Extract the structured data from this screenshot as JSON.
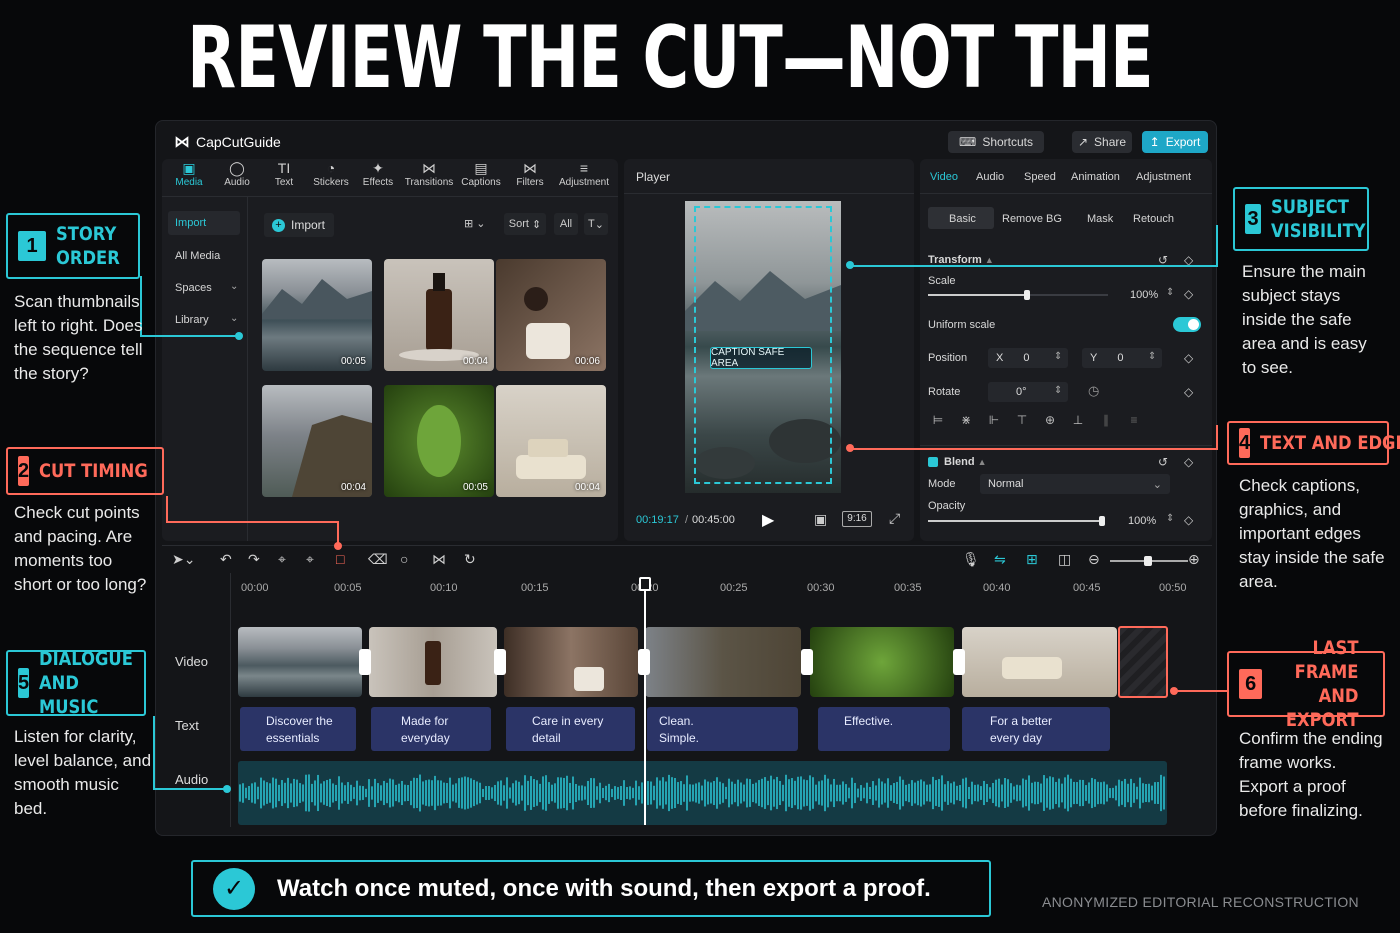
{
  "headline": "REVIEW THE CUT—NOT THE EFFECTS",
  "app": {
    "logo": "CapCutGuide",
    "shortcuts": "Shortcuts",
    "share": "Share",
    "export": "Export"
  },
  "toolbar": {
    "items": [
      {
        "label": "Media",
        "icon": "media-icon"
      },
      {
        "label": "Audio",
        "icon": "audio-icon"
      },
      {
        "label": "Text",
        "icon": "text-icon"
      },
      {
        "label": "Stickers",
        "icon": "stickers-icon"
      },
      {
        "label": "Effects",
        "icon": "effects-icon"
      },
      {
        "label": "Transitions",
        "icon": "transitions-icon"
      },
      {
        "label": "Captions",
        "icon": "captions-icon"
      },
      {
        "label": "Filters",
        "icon": "filters-icon"
      },
      {
        "label": "Adjustment",
        "icon": "adjustment-icon"
      }
    ]
  },
  "sidebar": {
    "items": [
      "Import",
      "All Media",
      "Spaces",
      "Library"
    ]
  },
  "media": {
    "import": "Import",
    "sort": "Sort",
    "all": "All",
    "type": "T",
    "thumbs": [
      {
        "duration": "00:05",
        "subject": "mountain lake"
      },
      {
        "duration": "00:04",
        "subject": "amber bottle"
      },
      {
        "duration": "00:06",
        "subject": "pouring cup"
      },
      {
        "duration": "00:04",
        "subject": "coastal cliffs"
      },
      {
        "duration": "00:05",
        "subject": "green leaves"
      },
      {
        "duration": "00:04",
        "subject": "soap and towels"
      }
    ]
  },
  "player": {
    "label": "Player",
    "caption_safe": "CAPTION SAFE AREA",
    "current_time": "00:19:17",
    "total_time": "00:45:00",
    "ratio": "9:16"
  },
  "props": {
    "tabs": [
      "Video",
      "Audio",
      "Speed",
      "Animation",
      "Adjustment"
    ],
    "subtabs": [
      "Basic",
      "Remove BG",
      "Mask",
      "Retouch"
    ],
    "transform": "Transform",
    "scale_label": "Scale",
    "scale_value": "100%",
    "scale_level": 0.55,
    "uniform_scale": "Uniform scale",
    "position": "Position",
    "x_label": "X",
    "x_value": "0",
    "y_label": "Y",
    "y_value": "0",
    "rotate": "Rotate",
    "rotate_value": "0°",
    "blend": "Blend",
    "mode": "Mode",
    "mode_value": "Normal",
    "opacity": "Opacity",
    "opacity_value": "100%",
    "opacity_level": 1.0
  },
  "timeline": {
    "ruler": [
      "00:00",
      "00:05",
      "00:10",
      "00:15",
      "00:20",
      "00:25",
      "00:30",
      "00:35",
      "00:40",
      "00:45",
      "00:50"
    ],
    "tracks": [
      "Video",
      "Text",
      "Audio"
    ],
    "text_clips": [
      "Discover the essentials",
      "Made for everyday",
      "Care in every detail",
      "Clean. Simple.",
      "Effective.",
      "For a better every day"
    ]
  },
  "annotations": [
    {
      "num": "1",
      "title": "STORY ORDER",
      "text": "Scan thumbnails left to right. Does the sequence tell the story?",
      "color": "#2bc8d6"
    },
    {
      "num": "2",
      "title": "CUT TIMING",
      "text": "Check cut points and pacing. Are moments too short or too long?",
      "color": "#ff6a5a"
    },
    {
      "num": "3",
      "title": "SUBJECT VISIBILITY",
      "text": "Ensure the main subject stays inside the safe area and is easy to see.",
      "color": "#2bc8d6"
    },
    {
      "num": "4",
      "title": "TEXT AND EDGES",
      "text": "Check captions, graphics, and important edges stay inside the safe area.",
      "color": "#ff6a5a"
    },
    {
      "num": "5",
      "title": "DIALOGUE AND MUSIC",
      "text": "Listen for clarity, level balance, and smooth music bed.",
      "color": "#2bc8d6"
    },
    {
      "num": "6",
      "title": "LAST FRAME AND EXPORT",
      "text": "Confirm the ending frame works. Export a proof before finalizing.",
      "color": "#ff6a5a"
    }
  ],
  "footer": {
    "tip": "Watch once muted, once with sound, then export a proof.",
    "credit": "ANONYMIZED EDITORIAL RECONSTRUCTION"
  },
  "colors": {
    "accent": "#2bc8d6",
    "warning": "#ff6a5a",
    "text_clip": "#2b3467",
    "export": "#1ea7c7"
  }
}
